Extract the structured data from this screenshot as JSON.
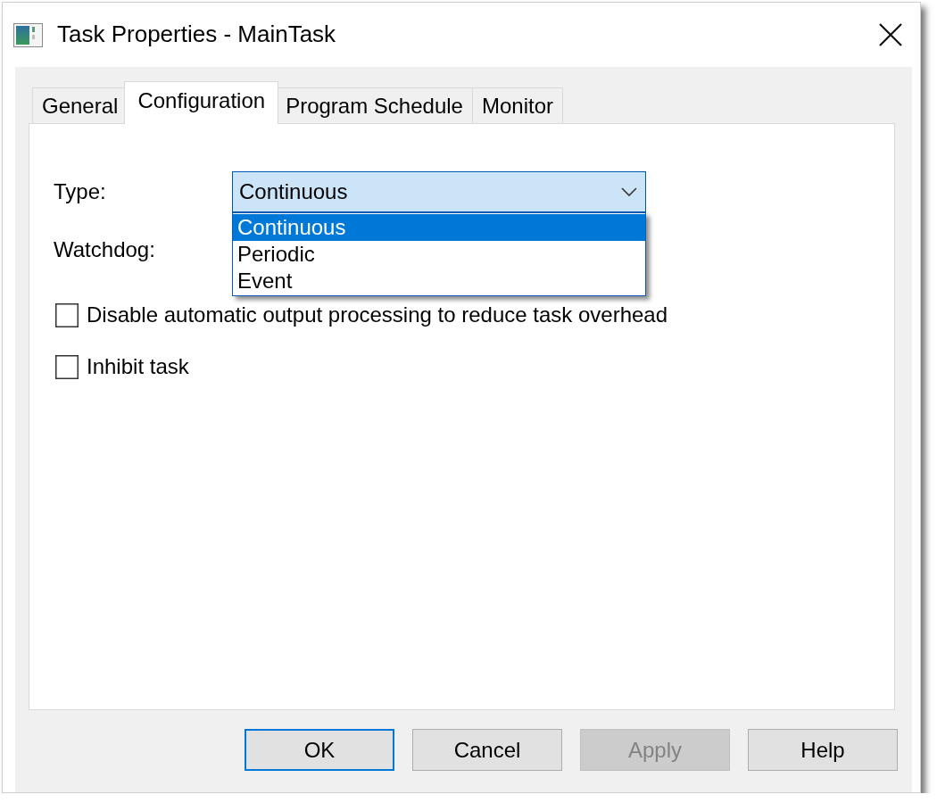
{
  "window": {
    "title": "Task Properties - MainTask"
  },
  "tabs": [
    {
      "label": "General",
      "selected": false
    },
    {
      "label": "Configuration",
      "selected": true
    },
    {
      "label": "Program Schedule",
      "selected": false
    },
    {
      "label": "Monitor",
      "selected": false
    }
  ],
  "type_field": {
    "label": "Type:",
    "value": "Continuous",
    "expanded": true,
    "options": [
      {
        "label": "Continuous",
        "selected": true
      },
      {
        "label": "Periodic",
        "selected": false
      },
      {
        "label": "Event",
        "selected": false
      }
    ]
  },
  "watchdog_field": {
    "label": "Watchdog:"
  },
  "checkboxes": [
    {
      "label": "Disable automatic output processing to reduce task overhead",
      "checked": false
    },
    {
      "label": "Inhibit task",
      "checked": false
    }
  ],
  "buttons": [
    {
      "label": "OK",
      "default": true,
      "disabled": false
    },
    {
      "label": "Cancel",
      "default": false,
      "disabled": false
    },
    {
      "label": "Apply",
      "default": false,
      "disabled": true
    },
    {
      "label": "Help",
      "default": false,
      "disabled": false
    }
  ]
}
